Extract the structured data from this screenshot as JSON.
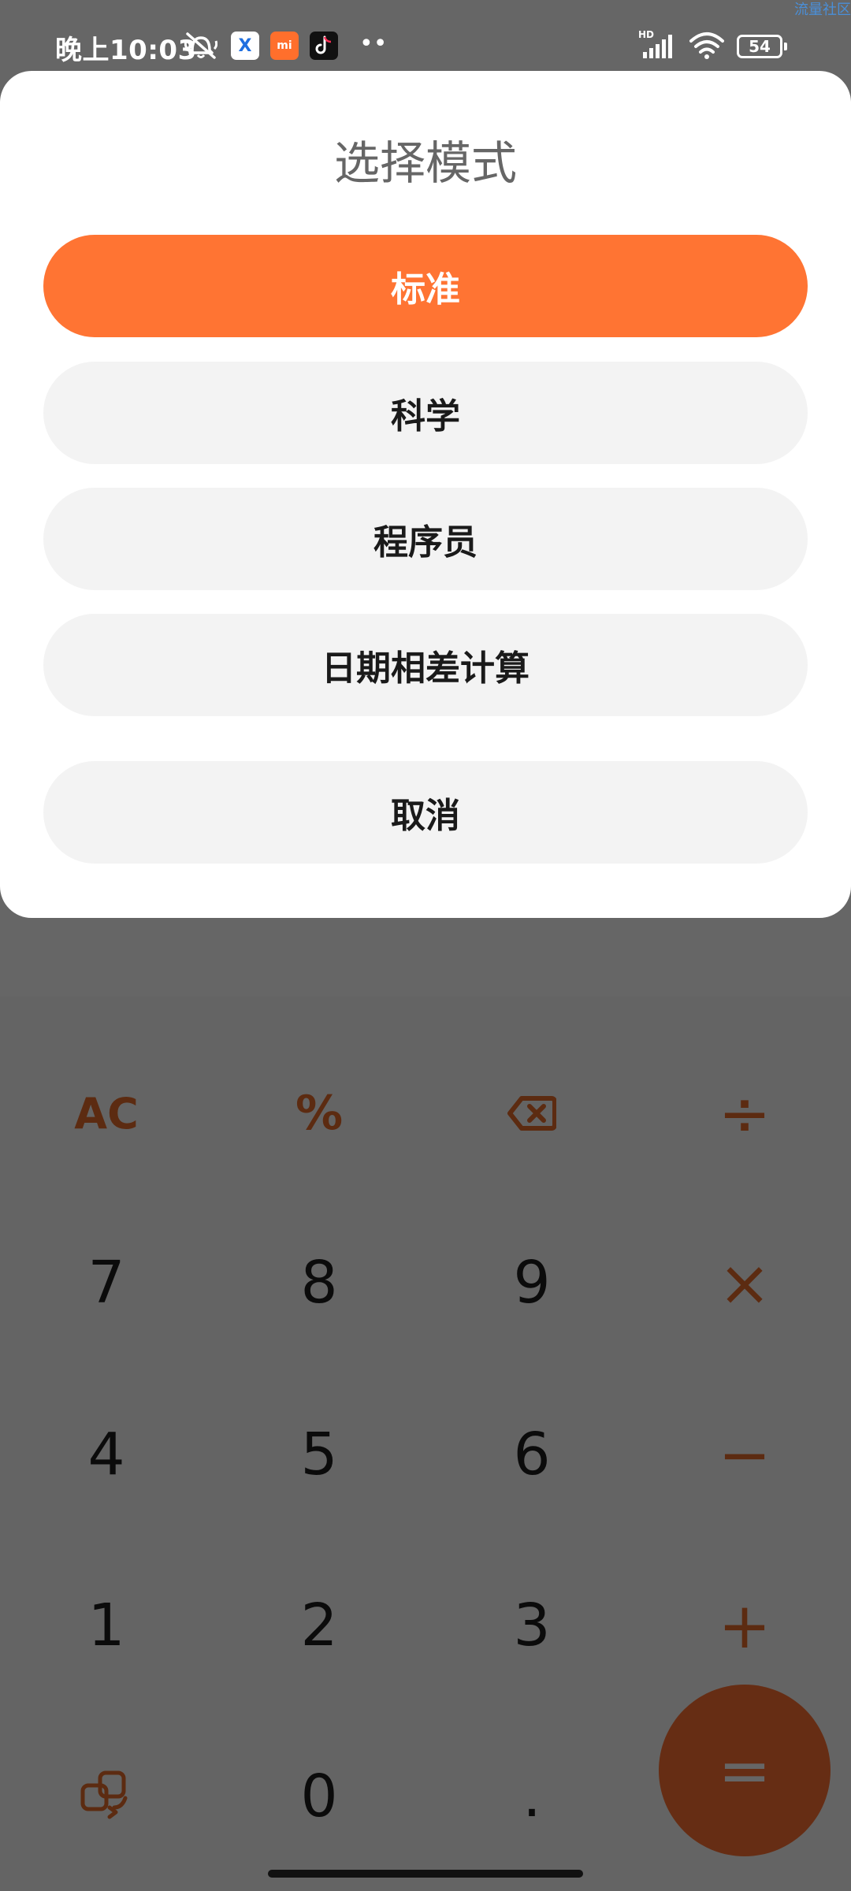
{
  "status_bar": {
    "time": "晚上10:03",
    "battery_level": "54",
    "watermark": "流量社区",
    "app_badge_x": "X",
    "app_badge_mi": "mi"
  },
  "dialog": {
    "title": "选择模式",
    "modes": [
      {
        "label": "标准",
        "selected": true
      },
      {
        "label": "科学",
        "selected": false
      },
      {
        "label": "程序员",
        "selected": false
      },
      {
        "label": "日期相差计算",
        "selected": false
      }
    ],
    "cancel_label": "取消"
  },
  "keypad": {
    "ac": "AC",
    "percent": "%",
    "divide": "÷",
    "multiply": "×",
    "minus": "−",
    "plus": "+",
    "equals": "=",
    "decimal": ".",
    "digits": {
      "d0": "0",
      "d1": "1",
      "d2": "2",
      "d3": "3",
      "d4": "4",
      "d5": "5",
      "d6": "6",
      "d7": "7",
      "d8": "8",
      "d9": "9"
    }
  },
  "colors": {
    "accent": "#ff7433",
    "scrim": "rgba(0,0,0,0.6)",
    "button_bg": "#f3f3f3"
  }
}
